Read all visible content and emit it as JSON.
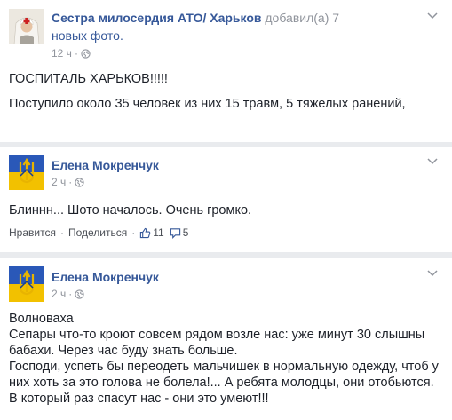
{
  "post1": {
    "author": "Сестра милосердия АТО/ Харьков",
    "action_text": "добавил(а) 7",
    "photos_link": "новых фото.",
    "time": "12 ч",
    "separator": "·",
    "headline": "ГОСПИТАЛЬ ХАРЬКОВ!!!!!",
    "text": "Поступило около 35 человек из них 15 травм, 5 тяжелых ранений,"
  },
  "post2": {
    "author": "Елена Мокренчук",
    "time": "2 ч",
    "separator": "·",
    "text": "Блиннн... Шото началось. Очень громко.",
    "like_label": "Нравится",
    "share_label": "Поделиться",
    "dot": "·",
    "likes_count": "11",
    "comments_count": "5"
  },
  "post3": {
    "author": "Елена Мокренчук",
    "time": "2 ч",
    "separator": "·",
    "lines": [
      "Волноваха",
      "Сепары что-то кроют совсем рядом возле нас: уже минут 30 слышны",
      "бабахи. Через час буду знать больше.",
      "Господи, успеть бы переодеть мальчишек в нормальную одежду, чтоб у",
      "них хоть за это голова не болела!... А ребята молодцы, они отобьются.",
      "В который раз спасут нас - они это умеют!!!"
    ]
  },
  "icons": {
    "globe": "globe-icon",
    "chevron": "chevron-down-icon",
    "thumb": "thumbs-up-icon",
    "comment": "comment-icon"
  },
  "colors": {
    "link": "#365899",
    "meta": "#90949c",
    "text": "#1d2129",
    "page_bg": "#e9ebee"
  }
}
